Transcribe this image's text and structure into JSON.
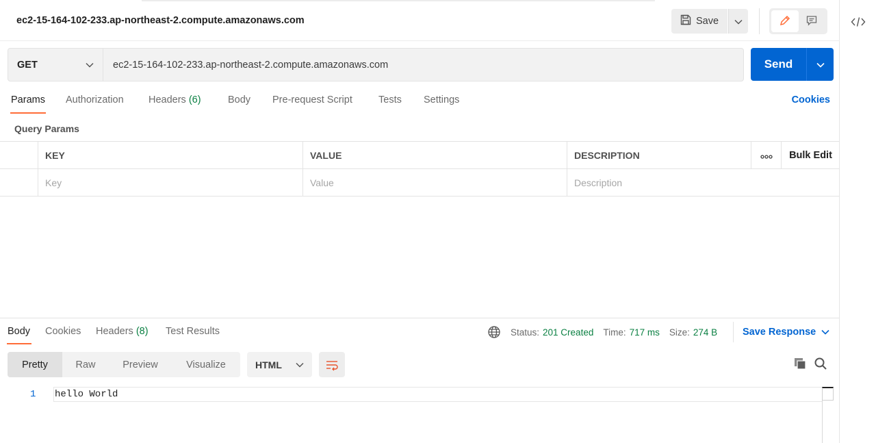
{
  "header": {
    "title": "ec2-15-164-102-233.ap-northeast-2.compute.amazonaws.com",
    "save_label": "Save"
  },
  "request": {
    "method": "GET",
    "url": "ec2-15-164-102-233.ap-northeast-2.compute.amazonaws.com",
    "send_label": "Send"
  },
  "request_tabs": [
    {
      "label": "Params",
      "count": ""
    },
    {
      "label": "Authorization",
      "count": ""
    },
    {
      "label": "Headers",
      "count": "(6)"
    },
    {
      "label": "Body",
      "count": ""
    },
    {
      "label": "Pre-request Script",
      "count": ""
    },
    {
      "label": "Tests",
      "count": ""
    },
    {
      "label": "Settings",
      "count": ""
    }
  ],
  "cookies_label": "Cookies",
  "query_params": {
    "section_label": "Query Params",
    "columns": [
      "KEY",
      "VALUE",
      "DESCRIPTION"
    ],
    "bulk_edit_label": "Bulk Edit",
    "placeholders": {
      "key": "Key",
      "value": "Value",
      "description": "Description"
    }
  },
  "response": {
    "tabs": [
      {
        "label": "Body",
        "count": ""
      },
      {
        "label": "Cookies",
        "count": ""
      },
      {
        "label": "Headers",
        "count": "(8)"
      },
      {
        "label": "Test Results",
        "count": ""
      }
    ],
    "status_label": "Status:",
    "status_value": "201 Created",
    "time_label": "Time:",
    "time_value": "717 ms",
    "size_label": "Size:",
    "size_value": "274 B",
    "save_response_label": "Save Response",
    "view_modes": [
      "Pretty",
      "Raw",
      "Preview",
      "Visualize"
    ],
    "format": "HTML",
    "lines": [
      {
        "number": "1",
        "text": "hello World"
      }
    ]
  },
  "colors": {
    "accent": "#ff6c37",
    "primary": "#0265d2",
    "success": "#0b8043"
  },
  "icons": [
    "save-icon",
    "chevron-down-icon",
    "pencil-icon",
    "comment-icon",
    "code-icon",
    "globe-icon",
    "more-icon",
    "wrap-lines-icon",
    "copy-icon",
    "search-icon"
  ]
}
